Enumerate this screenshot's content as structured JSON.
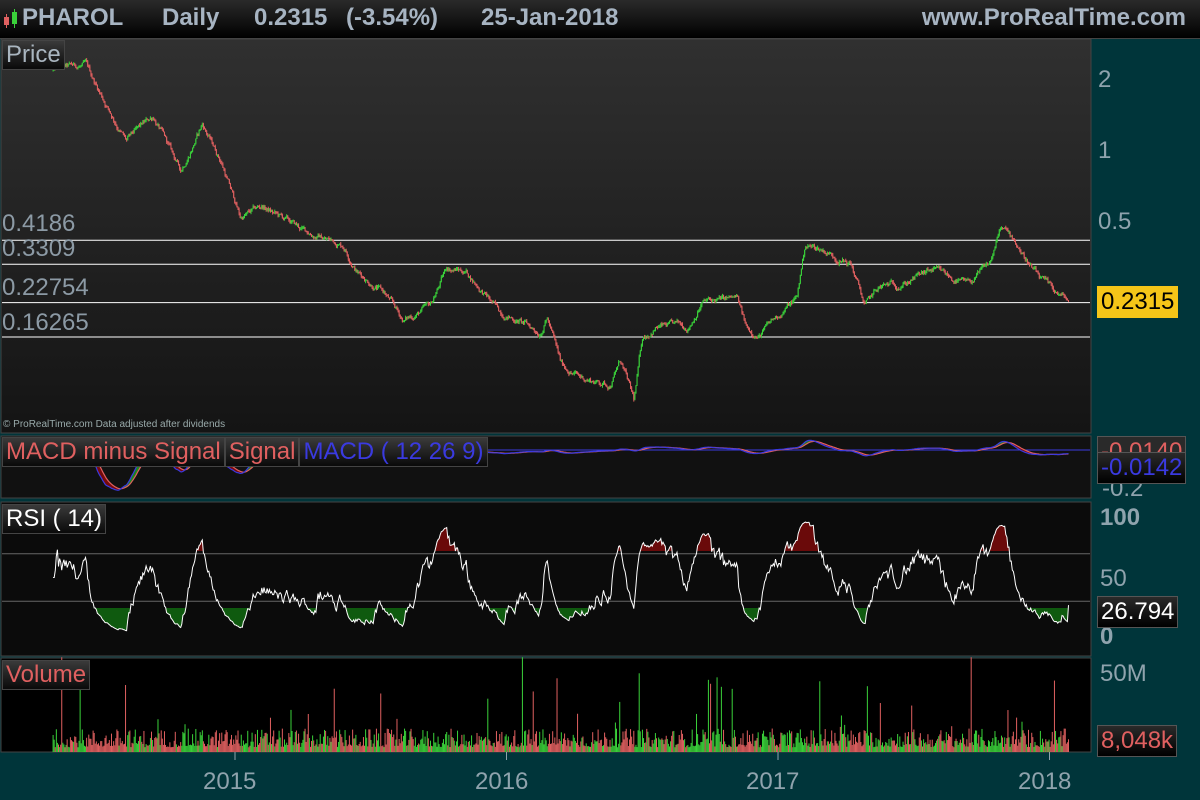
{
  "header": {
    "symbol": "PHAROL",
    "period": "Daily",
    "last_price": "0.2315",
    "change": "(-3.54%)",
    "date": "25-Jan-2018",
    "site": "www.ProRealTime.com",
    "icon": "candlestick-icon"
  },
  "price_panel": {
    "title": "Price",
    "copyright": "© ProRealTime.com  Data adjusted after dividends",
    "levels": [
      "0.4186",
      "0.3309",
      "0.22754",
      "0.16265"
    ],
    "axis_ticks": [
      "2",
      "1",
      "0.5"
    ],
    "last_tag": "0.2315"
  },
  "macd_panel": {
    "label_hist": "MACD minus Signal",
    "label_signal": "Signal",
    "label_macd": "MACD ( 12 26 9)",
    "signal_value": "-0.0140",
    "macd_value": "-0.0142",
    "axis_tick": "-0.2"
  },
  "rsi_panel": {
    "title": "RSI ( 14)",
    "axis_ticks": [
      "100",
      "50",
      "0"
    ],
    "value": "26.794"
  },
  "volume_panel": {
    "title": "Volume",
    "axis_tick": "50M",
    "value": "8,048k"
  },
  "time_axis": [
    "2015",
    "2016",
    "2017",
    "2018"
  ],
  "colors": {
    "up": "#3ad13a",
    "down": "#e06060",
    "macd": "#3a3ae0",
    "signal": "#e06060",
    "tag_price": "#f5c518",
    "axis_bg": "#00353a"
  },
  "chart_data": {
    "type": "candlestick",
    "title": "PHAROL Daily",
    "x_range": [
      2014.33,
      2018.07
    ],
    "y_scale": "log",
    "ylim": [
      0.07,
      2.6
    ],
    "price_keypoints": [
      [
        2014.33,
        2.2
      ],
      [
        2014.45,
        2.3
      ],
      [
        2014.55,
        1.4
      ],
      [
        2014.6,
        1.1
      ],
      [
        2014.7,
        1.4
      ],
      [
        2014.8,
        0.82
      ],
      [
        2014.88,
        1.3
      ],
      [
        2014.95,
        0.9
      ],
      [
        2015.02,
        0.52
      ],
      [
        2015.1,
        0.58
      ],
      [
        2015.25,
        0.46
      ],
      [
        2015.4,
        0.4
      ],
      [
        2015.45,
        0.31
      ],
      [
        2015.55,
        0.25
      ],
      [
        2015.62,
        0.19
      ],
      [
        2015.72,
        0.22
      ],
      [
        2015.78,
        0.32
      ],
      [
        2015.85,
        0.31
      ],
      [
        2015.97,
        0.21
      ],
      [
        2016.05,
        0.19
      ],
      [
        2016.12,
        0.17
      ],
      [
        2016.15,
        0.2
      ],
      [
        2016.2,
        0.125
      ],
      [
        2016.27,
        0.11
      ],
      [
        2016.38,
        0.102
      ],
      [
        2016.42,
        0.13
      ],
      [
        2016.47,
        0.086
      ],
      [
        2016.5,
        0.16
      ],
      [
        2016.55,
        0.18
      ],
      [
        2016.67,
        0.18
      ],
      [
        2016.72,
        0.23
      ],
      [
        2016.85,
        0.235
      ],
      [
        2016.88,
        0.18
      ],
      [
        2016.93,
        0.165
      ],
      [
        2017.0,
        0.2
      ],
      [
        2017.07,
        0.24
      ],
      [
        2017.1,
        0.4
      ],
      [
        2017.17,
        0.38
      ],
      [
        2017.27,
        0.33
      ],
      [
        2017.32,
        0.22
      ],
      [
        2017.37,
        0.26
      ],
      [
        2017.47,
        0.28
      ],
      [
        2017.57,
        0.31
      ],
      [
        2017.7,
        0.27
      ],
      [
        2017.78,
        0.33
      ],
      [
        2017.82,
        0.47
      ],
      [
        2017.87,
        0.42
      ],
      [
        2017.95,
        0.3
      ],
      [
        2018.0,
        0.26
      ],
      [
        2018.07,
        0.2315
      ]
    ],
    "levels": [
      0.4186,
      0.3309,
      0.22754,
      0.16265
    ],
    "last_close": 0.2315,
    "rsi": {
      "period": 14,
      "bands": [
        30,
        70
      ],
      "ylim": [
        0,
        100
      ],
      "last": 26.794
    },
    "macd": {
      "params": [
        12,
        26,
        9
      ],
      "macd_last": -0.0142,
      "signal_last": -0.014
    },
    "volume": {
      "last": 8048000,
      "max_tick": 50000000
    }
  }
}
